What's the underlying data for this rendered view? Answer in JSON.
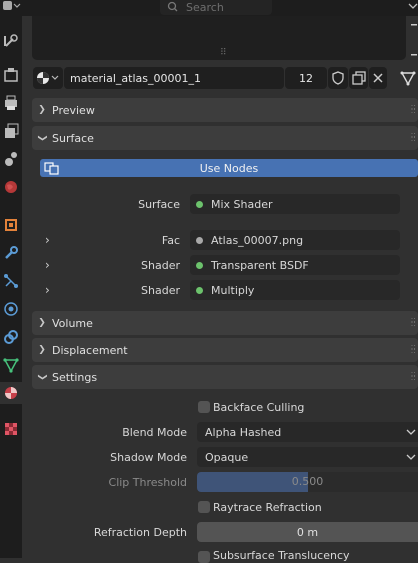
{
  "header": {
    "search_placeholder": "Search",
    "resize_glyph": "⠿"
  },
  "sidebar": {
    "tabs": [
      {
        "icon": "tool-icon"
      },
      {
        "icon": "render-icon"
      },
      {
        "icon": "output-icon"
      },
      {
        "icon": "view-layer-icon"
      },
      {
        "icon": "scene-icon"
      },
      {
        "icon": "world-icon"
      },
      {
        "icon": "object-icon"
      },
      {
        "icon": "modifier-icon"
      },
      {
        "icon": "particles-icon"
      },
      {
        "icon": "physics-icon"
      },
      {
        "icon": "constraints-icon"
      },
      {
        "icon": "data-icon"
      },
      {
        "icon": "material-icon"
      },
      {
        "icon": "texture-icon"
      }
    ]
  },
  "material": {
    "name": "material_atlas_00001_1",
    "users": "12"
  },
  "panels": {
    "preview": "Preview",
    "surface": "Surface",
    "volume": "Volume",
    "displacement": "Displacement",
    "settings": "Settings"
  },
  "surface": {
    "use_nodes": "Use Nodes",
    "surface_label": "Surface",
    "surface_value": "Mix Shader",
    "fac_label": "Fac",
    "fac_value": "Atlas_00007.png",
    "shader1_label": "Shader",
    "shader1_value": "Transparent BSDF",
    "shader2_label": "Shader",
    "shader2_value": "Multiply"
  },
  "settings": {
    "backface_culling": "Backface Culling",
    "blend_mode_label": "Blend Mode",
    "blend_mode_value": "Alpha Hashed",
    "shadow_mode_label": "Shadow Mode",
    "shadow_mode_value": "Opaque",
    "clip_threshold_label": "Clip Threshold",
    "clip_threshold_value": "0.500",
    "clip_threshold_fraction": 0.5,
    "raytrace_refraction": "Raytrace Refraction",
    "refraction_depth_label": "Refraction Depth",
    "refraction_depth_value": "0 m",
    "subsurface_translucency": "Subsurface Translucency"
  },
  "colors": {
    "accent": "#4772b3",
    "socket_green": "#6cc26c",
    "material_red": "#c8404a"
  }
}
